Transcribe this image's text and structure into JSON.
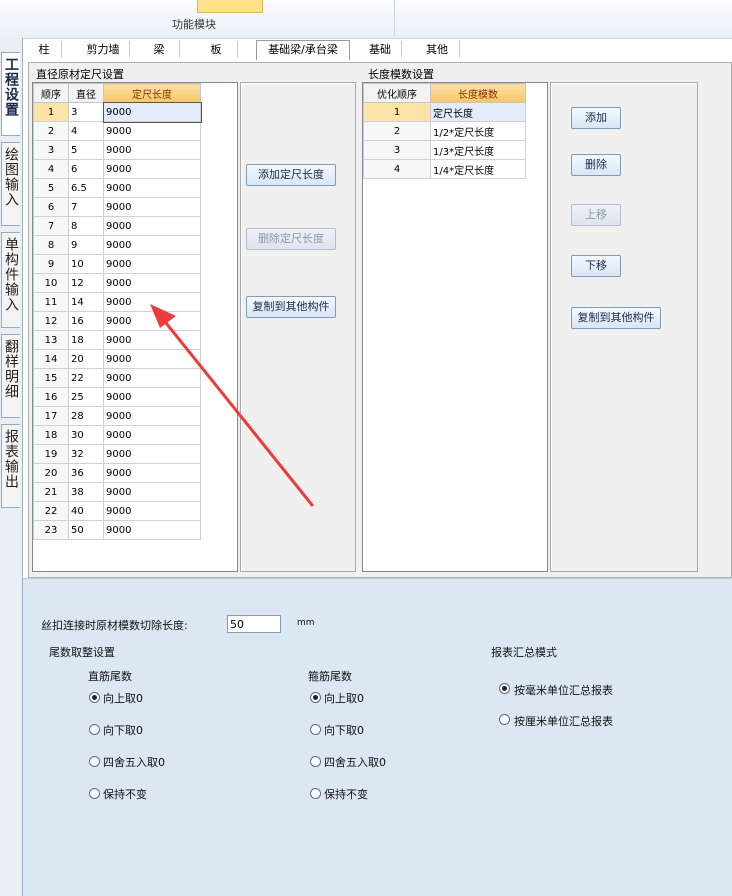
{
  "ribbon": {
    "module_label": "功能模块"
  },
  "left_tabs": [
    {
      "label": "工程设置",
      "active": true
    },
    {
      "label": "绘图输入",
      "active": false
    },
    {
      "label": "单构件输入",
      "active": false
    },
    {
      "label": "翻样明细",
      "active": false
    },
    {
      "label": "报表输出",
      "active": false
    }
  ],
  "tabs": [
    {
      "label": "柱",
      "active": false
    },
    {
      "label": "剪力墙",
      "active": false
    },
    {
      "label": "梁",
      "active": false
    },
    {
      "label": "板",
      "active": false
    },
    {
      "label": "基础梁/承台梁",
      "active": true
    },
    {
      "label": "基础",
      "active": false
    },
    {
      "label": "其他",
      "active": false
    }
  ],
  "diameter_panel": {
    "title": "直径原材定尺设置",
    "columns": [
      "顺序",
      "直径",
      "定尺长度"
    ],
    "rows": [
      [
        "1",
        "3",
        "9000"
      ],
      [
        "2",
        "4",
        "9000"
      ],
      [
        "3",
        "5",
        "9000"
      ],
      [
        "4",
        "6",
        "9000"
      ],
      [
        "5",
        "6.5",
        "9000"
      ],
      [
        "6",
        "7",
        "9000"
      ],
      [
        "7",
        "8",
        "9000"
      ],
      [
        "8",
        "9",
        "9000"
      ],
      [
        "9",
        "10",
        "9000"
      ],
      [
        "10",
        "12",
        "9000"
      ],
      [
        "11",
        "14",
        "9000"
      ],
      [
        "12",
        "16",
        "9000"
      ],
      [
        "13",
        "18",
        "9000"
      ],
      [
        "14",
        "20",
        "9000"
      ],
      [
        "15",
        "22",
        "9000"
      ],
      [
        "16",
        "25",
        "9000"
      ],
      [
        "17",
        "28",
        "9000"
      ],
      [
        "18",
        "30",
        "9000"
      ],
      [
        "19",
        "32",
        "9000"
      ],
      [
        "20",
        "36",
        "9000"
      ],
      [
        "21",
        "38",
        "9000"
      ],
      [
        "22",
        "40",
        "9000"
      ],
      [
        "23",
        "50",
        "9000"
      ]
    ],
    "buttons": {
      "add": "添加定尺长度",
      "delete": "删除定尺长度",
      "copy": "复制到其他构件"
    }
  },
  "modulus_panel": {
    "title": "长度模数设置",
    "columns": [
      "优化顺序",
      "长度模数"
    ],
    "rows": [
      [
        "1",
        "定尺长度"
      ],
      [
        "2",
        "1/2*定尺长度"
      ],
      [
        "3",
        "1/3*定尺长度"
      ],
      [
        "4",
        "1/4*定尺长度"
      ]
    ],
    "buttons": {
      "add": "添加",
      "delete": "删除",
      "up": "上移",
      "down": "下移",
      "copy": "复制到其他构件"
    }
  },
  "settings": {
    "cut_label": "丝扣连接时原材模数切除长度:",
    "cut_value": "50",
    "cut_unit": "mm",
    "tail_title": "尾数取整设置",
    "straight_title": "直筋尾数",
    "stirrup_title": "箍筋尾数",
    "options": [
      "向上取0",
      "向下取0",
      "四舍五入取0",
      "保持不变"
    ],
    "report_title": "报表汇总模式",
    "report_options": [
      "按毫米单位汇总报表",
      "按厘米单位汇总报表"
    ]
  }
}
